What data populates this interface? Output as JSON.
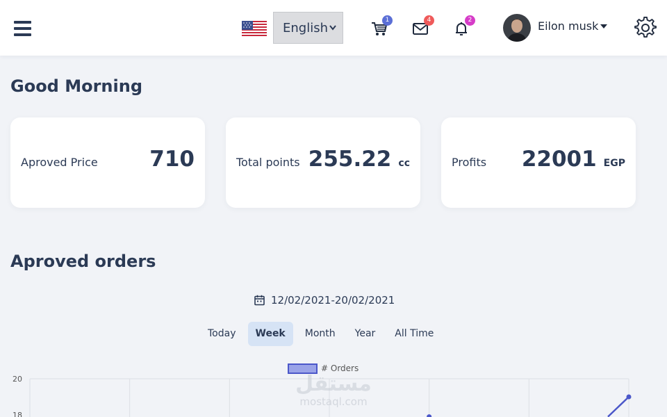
{
  "header": {
    "language": {
      "selected": "English",
      "flag": "us-flag-icon"
    },
    "cart": {
      "icon": "cart-icon",
      "badge": "1",
      "badge_color": "#5b6fd6"
    },
    "mail": {
      "icon": "envelope-icon",
      "badge": "4",
      "badge_color": "#ef5a5a"
    },
    "notifications": {
      "icon": "bell-icon",
      "badge": "2",
      "badge_color": "#d63cc8"
    },
    "user": {
      "name": "Eilon musk"
    },
    "settings_icon": "gear-icon"
  },
  "greeting": "Good Morning",
  "stats": [
    {
      "label": "Aproved Price",
      "value": "710",
      "unit": ""
    },
    {
      "label": "Total points",
      "value": "255.22",
      "unit": "cc"
    },
    {
      "label": "Profits",
      "value": "22001",
      "unit": "EGP"
    }
  ],
  "orders": {
    "title": "Aproved orders",
    "date_range": "12/02/2021-20/02/2021",
    "periods": [
      "Today",
      "Week",
      "Month",
      "Year",
      "All Time"
    ],
    "active_period": "Week"
  },
  "chart_data": {
    "type": "line",
    "legend": "# Orders",
    "series": [
      {
        "name": "# Orders",
        "points": [
          [
            5,
            18
          ],
          [
            7,
            19
          ]
        ]
      }
    ],
    "yticks": [
      20,
      18
    ],
    "ylim": [
      18,
      20
    ],
    "x_count": 7,
    "color": "#4b57c9",
    "fill": "#9aa3e8"
  },
  "watermark": {
    "arabic": "مستقل",
    "latin": "mostaql.com"
  },
  "colors": {
    "accent": "#2b3a55",
    "active_tab": "#d6e3f5"
  }
}
